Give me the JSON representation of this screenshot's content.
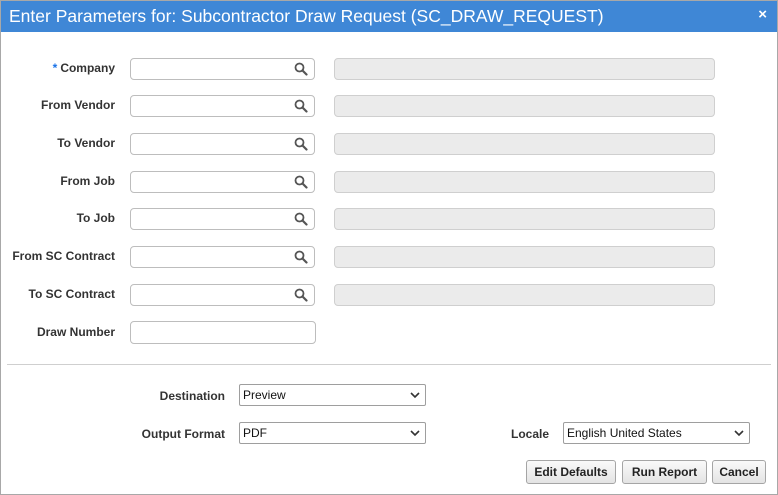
{
  "dialog": {
    "title": "Enter Parameters for: Subcontractor Draw Request (SC_DRAW_REQUEST)",
    "close_glyph": "×"
  },
  "fields": {
    "required_marker": "*",
    "company": {
      "label": "Company",
      "value": "",
      "description": ""
    },
    "from_vendor": {
      "label": "From Vendor",
      "value": "",
      "description": ""
    },
    "to_vendor": {
      "label": "To Vendor",
      "value": "",
      "description": ""
    },
    "from_job": {
      "label": "From Job",
      "value": "",
      "description": ""
    },
    "to_job": {
      "label": "To Job",
      "value": "",
      "description": ""
    },
    "from_sc_contract": {
      "label": "From SC Contract",
      "value": "",
      "description": ""
    },
    "to_sc_contract": {
      "label": "To SC Contract",
      "value": "",
      "description": ""
    },
    "draw_number": {
      "label": "Draw Number",
      "value": ""
    }
  },
  "output": {
    "destination": {
      "label": "Destination",
      "value": "Preview"
    },
    "output_format": {
      "label": "Output Format",
      "value": "PDF"
    },
    "locale": {
      "label": "Locale",
      "value": "English United States"
    }
  },
  "buttons": {
    "edit_defaults": "Edit Defaults",
    "run_report": "Run Report",
    "cancel": "Cancel"
  },
  "icons": {
    "lookup": "search-icon",
    "dropdown": "chevron-down-icon",
    "close": "close-icon"
  },
  "colors": {
    "titlebar": "#3f87d6",
    "required_marker": "#1a73e8",
    "readonly_field": "#ebebeb"
  }
}
